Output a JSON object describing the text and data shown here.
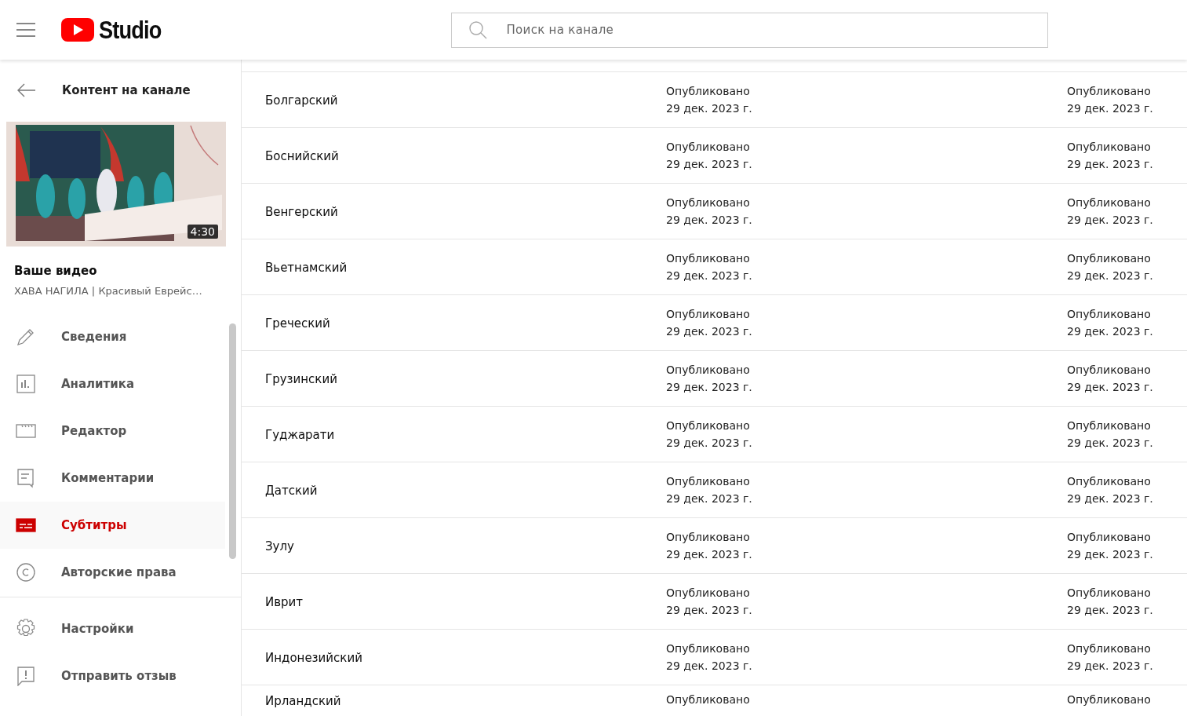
{
  "header": {
    "logo_text": "Studio",
    "search": {
      "placeholder": "Поиск на канале"
    }
  },
  "sidebar": {
    "back_label": "Контент на канале",
    "video": {
      "duration": "4:30",
      "heading": "Ваше видео",
      "title": "ХАВА НАГИЛА | Красивый Еврейс…"
    },
    "items": [
      {
        "kind": "pencil",
        "label": "Сведения",
        "selected": false
      },
      {
        "kind": "chart",
        "label": "Аналитика",
        "selected": false
      },
      {
        "kind": "clapper",
        "label": "Редактор",
        "selected": false
      },
      {
        "kind": "comment",
        "label": "Комментарии",
        "selected": false
      },
      {
        "kind": "subtitles",
        "label": "Субтитры",
        "selected": true
      },
      {
        "kind": "copyright",
        "label": "Авторские права",
        "selected": false
      }
    ],
    "footer_items": [
      {
        "kind": "gear",
        "label": "Настройки"
      },
      {
        "kind": "feedback",
        "label": "Отправить отзыв"
      }
    ]
  },
  "table": {
    "rows": [
      {
        "language": "Болгарский",
        "column_2": [
          "Опубликовано",
          "29 дек. 2023 г."
        ],
        "column_3": [
          "Опубликовано",
          "29 дек. 2023 г."
        ]
      },
      {
        "language": "Боснийский",
        "column_2": [
          "Опубликовано",
          "29 дек. 2023 г."
        ],
        "column_3": [
          "Опубликовано",
          "29 дек. 2023 г."
        ]
      },
      {
        "language": "Венгерский",
        "column_2": [
          "Опубликовано",
          "29 дек. 2023 г."
        ],
        "column_3": [
          "Опубликовано",
          "29 дек. 2023 г."
        ]
      },
      {
        "language": "Вьетнамский",
        "column_2": [
          "Опубликовано",
          "29 дек. 2023 г."
        ],
        "column_3": [
          "Опубликовано",
          "29 дек. 2023 г."
        ]
      },
      {
        "language": "Греческий",
        "column_2": [
          "Опубликовано",
          "29 дек. 2023 г."
        ],
        "column_3": [
          "Опубликовано",
          "29 дек. 2023 г."
        ]
      },
      {
        "language": "Грузинский",
        "column_2": [
          "Опубликовано",
          "29 дек. 2023 г."
        ],
        "column_3": [
          "Опубликовано",
          "29 дек. 2023 г."
        ]
      },
      {
        "language": "Гуджарати",
        "column_2": [
          "Опубликовано",
          "29 дек. 2023 г."
        ],
        "column_3": [
          "Опубликовано",
          "29 дек. 2023 г."
        ]
      },
      {
        "language": "Датский",
        "column_2": [
          "Опубликовано",
          "29 дек. 2023 г."
        ],
        "column_3": [
          "Опубликовано",
          "29 дек. 2023 г."
        ]
      },
      {
        "language": "Зулу",
        "column_2": [
          "Опубликовано",
          "29 дек. 2023 г."
        ],
        "column_3": [
          "Опубликовано",
          "29 дек. 2023 г."
        ]
      },
      {
        "language": "Иврит",
        "column_2": [
          "Опубликовано",
          "29 дек. 2023 г."
        ],
        "column_3": [
          "Опубликовано",
          "29 дек. 2023 г."
        ]
      },
      {
        "language": "Индонезийский",
        "column_2": [
          "Опубликовано",
          "29 дек. 2023 г."
        ],
        "column_3": [
          "Опубликовано",
          "29 дек. 2023 г."
        ]
      },
      {
        "language": "Ирландский",
        "column_2": [
          "Опубликовано"
        ],
        "column_3": [
          "Опубликовано"
        ]
      }
    ]
  }
}
